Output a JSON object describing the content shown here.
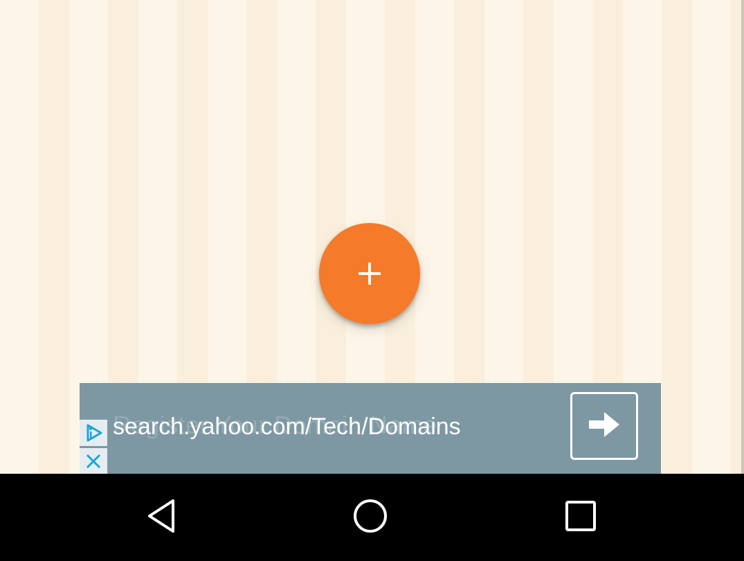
{
  "fab": {
    "icon": "plus-icon",
    "color": "#f57a2a"
  },
  "ad": {
    "ghost_text": "Register Your Domain Name",
    "text": "search.yahoo.com/Tech/Domains",
    "background": "#7d98a3",
    "choices_icon": "adchoices-icon",
    "close_icon": "close-icon",
    "arrow_icon": "arrow-right-icon"
  },
  "nav": {
    "back_icon": "back-triangle-icon",
    "home_icon": "home-circle-icon",
    "recents_icon": "recents-square-icon"
  }
}
